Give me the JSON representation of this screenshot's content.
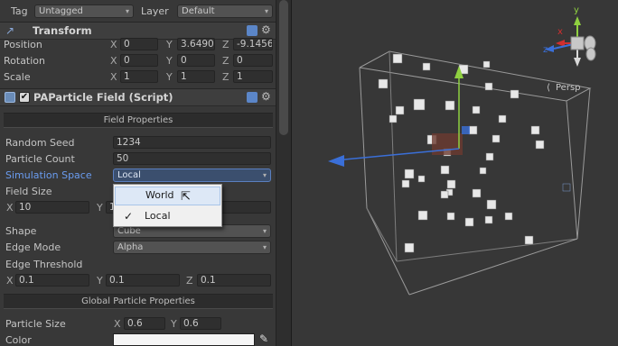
{
  "inspector": {
    "tag_label": "Tag",
    "tag_value": "Untagged",
    "layer_label": "Layer",
    "layer_value": "Default",
    "transform": {
      "title": "Transform",
      "position": {
        "label": "Position",
        "x": "0",
        "y": "3.64908",
        "z": "-9.1456"
      },
      "rotation": {
        "label": "Rotation",
        "x": "0",
        "y": "0",
        "z": "0"
      },
      "scale": {
        "label": "Scale",
        "x": "1",
        "y": "1",
        "z": "1"
      }
    },
    "script": {
      "title": "PAParticle Field (Script)",
      "enabled": true,
      "section_field": "Field Properties",
      "random_seed": {
        "label": "Random Seed",
        "value": "1234"
      },
      "particle_count": {
        "label": "Particle Count",
        "value": "50"
      },
      "simulation_space": {
        "label": "Simulation Space",
        "value": "Local"
      },
      "field_size": {
        "label": "Field Size",
        "x": "10",
        "y": "1"
      },
      "shape": {
        "label": "Shape",
        "value": "Cube"
      },
      "edge_mode": {
        "label": "Edge Mode",
        "value": "Alpha"
      },
      "edge_threshold": {
        "label": "Edge Threshold",
        "x": "0.1",
        "y": "0.1",
        "z": "0.1"
      },
      "section_global": "Global Particle Properties",
      "particle_size": {
        "label": "Particle Size",
        "x": "0.6",
        "y": "0.6"
      },
      "color": {
        "label": "Color"
      }
    },
    "axes": {
      "x": "X",
      "y": "Y",
      "z": "Z"
    }
  },
  "popup": {
    "items": [
      {
        "label": "World",
        "checked": false,
        "hovered": true
      },
      {
        "label": "Local",
        "checked": true,
        "hovered": false
      }
    ],
    "check_glyph": "✓"
  },
  "scene": {
    "persp_label": "Persp",
    "gizmo": {
      "x": "x",
      "y": "y",
      "z": "z"
    }
  },
  "colors": {
    "accent_blue": "#6a9cf0",
    "axis_x": "#d02f2f",
    "axis_y": "#8fd040",
    "axis_z": "#3a6fd8",
    "selection": "#5a7fbf"
  }
}
